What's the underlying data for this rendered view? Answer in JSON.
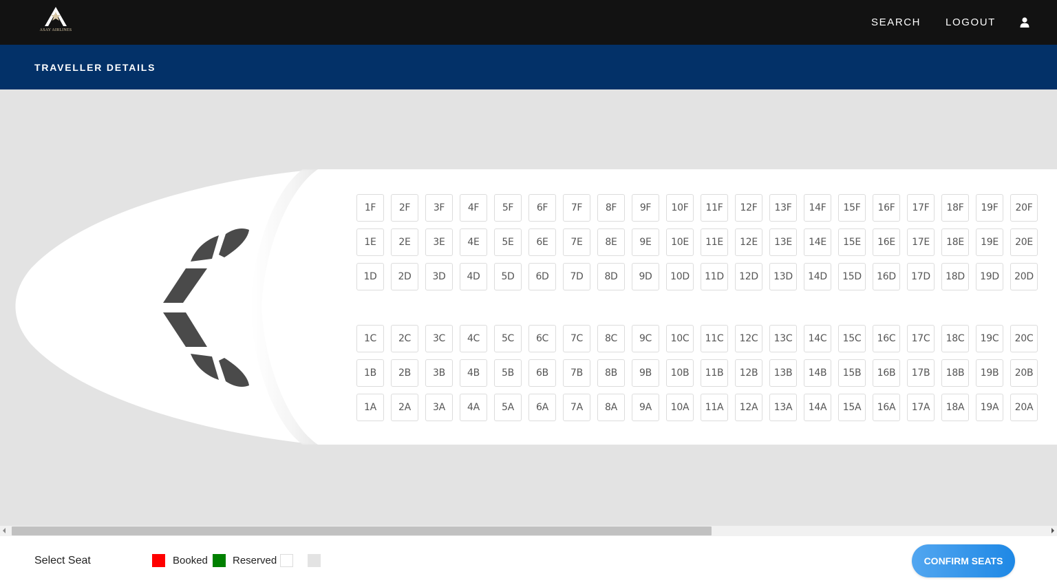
{
  "brand": {
    "logo_name": "ASAY AIRLINES",
    "logo_color": "#d9c8a6"
  },
  "nav": {
    "search_label": "SEARCH",
    "logout_label": "LOGOUT",
    "user_icon": "user-icon"
  },
  "page": {
    "title": "TRAVELLER DETAILS"
  },
  "seatmap": {
    "columns": 20,
    "upper_rows": [
      "F",
      "E",
      "D"
    ],
    "lower_rows": [
      "C",
      "B",
      "A"
    ]
  },
  "legend": {
    "select_label": "Select Seat",
    "booked_label": "Booked",
    "booked_color": "#ff0000",
    "reserved_label": "Reserved",
    "reserved_color": "#008000",
    "available_color": "#ffffff",
    "blocked_color": "#e3e3e3"
  },
  "actions": {
    "confirm_label": "CONFIRM SEATS"
  },
  "colors": {
    "topbar": "#121212",
    "subbar": "#033168",
    "cabin_bg": "#e3e3e3",
    "accent": "#1e88e5"
  }
}
